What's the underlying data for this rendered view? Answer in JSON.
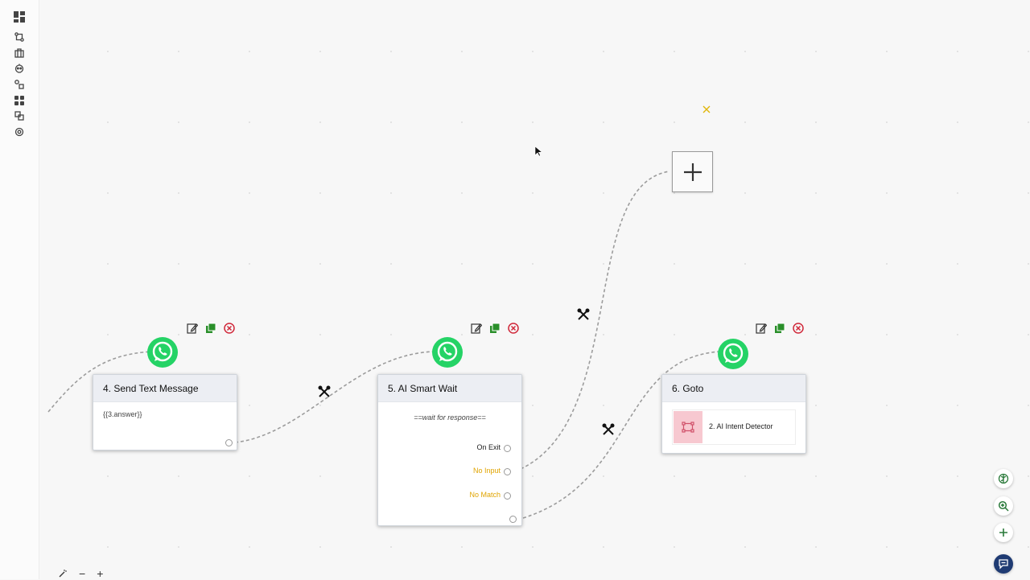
{
  "sidebar": {
    "items": [
      "dashboard-icon",
      "flows-icon",
      "briefcase-icon",
      "bot-icon",
      "shapes-icon",
      "apps-icon",
      "layers-icon",
      "settings-icon"
    ]
  },
  "nodes": {
    "send_text": {
      "title": "4. Send Text Message",
      "content": "{{3.answer}}"
    },
    "smart_wait": {
      "title": "5. AI Smart Wait",
      "subtitle": "==wait for response==",
      "outputs": {
        "on_exit": "On Exit",
        "no_input": "No Input",
        "no_match": "No Match"
      }
    },
    "goto": {
      "title": "6. Goto",
      "target": "2. AI Intent Detector"
    }
  },
  "bottom_toolbar": {
    "minus": "−",
    "plus": "+"
  },
  "colors": {
    "whatsapp": "#25D366",
    "no_input": "#e0a400",
    "no_match": "#e0a400",
    "edit": "#333333",
    "copy": "#2a8f2a",
    "delete": "#d0283a",
    "chat_button": "#1f3b73",
    "goto_thumb": "#f7c8d0"
  }
}
